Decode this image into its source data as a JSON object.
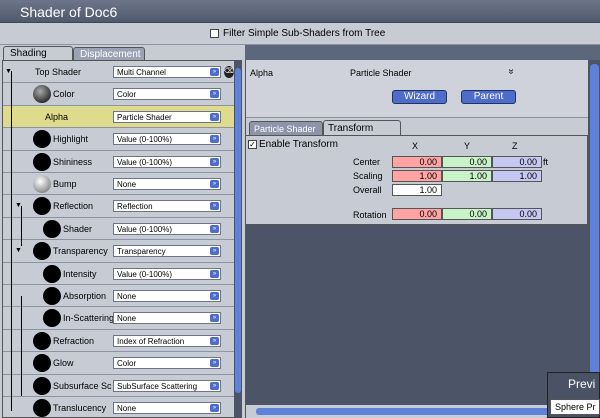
{
  "window": {
    "title": "Shader of Doc6"
  },
  "filter": {
    "label": "Filter Simple Sub-Shaders from Tree",
    "checked": false
  },
  "left_tabs": [
    {
      "label": "Shading",
      "active": true
    },
    {
      "label": "Displacement",
      "active": false
    }
  ],
  "tree": [
    {
      "label": "Top Shader",
      "value": "Multi Channel",
      "level": 0,
      "swatch": "none",
      "expanded": true
    },
    {
      "label": "Color",
      "value": "Color",
      "level": 1,
      "swatch": "grey"
    },
    {
      "label": "Alpha",
      "value": "Particle Shader",
      "level": 1,
      "swatch": "none",
      "selected": true
    },
    {
      "label": "Highlight",
      "value": "Value (0-100%)",
      "level": 1,
      "swatch": "black"
    },
    {
      "label": "Shininess",
      "value": "Value (0-100%)",
      "level": 1,
      "swatch": "black"
    },
    {
      "label": "Bump",
      "value": "None",
      "level": 1,
      "swatch": "light"
    },
    {
      "label": "Reflection",
      "value": "Reflection",
      "level": 1,
      "swatch": "black",
      "expanded": true
    },
    {
      "label": "Shader",
      "value": "Value (0-100%)",
      "level": 2,
      "swatch": "black"
    },
    {
      "label": "Transparency",
      "value": "Transparency",
      "level": 1,
      "swatch": "black",
      "expanded": true
    },
    {
      "label": "Intensity",
      "value": "Value (0-100%)",
      "level": 2,
      "swatch": "black"
    },
    {
      "label": "Absorption",
      "value": "None",
      "level": 2,
      "swatch": "black"
    },
    {
      "label": "In-Scattering",
      "value": "None",
      "level": 2,
      "swatch": "black"
    },
    {
      "label": "Refraction",
      "value": "Index of Refraction",
      "level": 1,
      "swatch": "black"
    },
    {
      "label": "Glow",
      "value": "Color",
      "level": 1,
      "swatch": "black"
    },
    {
      "label": "Subsurface Sc",
      "value": "SubSurface Scattering",
      "level": 1,
      "swatch": "black"
    },
    {
      "label": "Translucency",
      "value": "None",
      "level": 1,
      "swatch": "black"
    }
  ],
  "right_header": {
    "channel": "Alpha",
    "shader_type": "Particle Shader",
    "collapse_glyph": "»",
    "wizard_label": "Wizard",
    "parent_label": "Parent"
  },
  "right_tabs": [
    {
      "label": "Particle Shader",
      "active": false
    },
    {
      "label": "Transform",
      "active": true
    }
  ],
  "transform": {
    "enable_label": "Enable Transform",
    "enabled": true,
    "col_x": "X",
    "col_y": "Y",
    "col_z": "Z",
    "center_label": "Center",
    "center": [
      "0.00",
      "0.00",
      "0.00"
    ],
    "center_unit": "ft",
    "scaling_label": "Scaling",
    "scaling": [
      "1.00",
      "1.00",
      "1.00"
    ],
    "overall_label": "Overall",
    "overall": "1.00",
    "rotation_label": "Rotation",
    "rotation": [
      "0.00",
      "0.00",
      "0.00"
    ]
  },
  "preview": {
    "title": "Previ",
    "shape": "Sphere Pr"
  },
  "icons": {
    "trash": "trash-icon",
    "dropdown": "dropdown-arrow-icon",
    "check": "✓"
  },
  "colors": {
    "selected_row": "#dfdb8c",
    "button": "#4e6cc9",
    "x_field": "#ffa3a3",
    "y_field": "#c8f2c8",
    "z_field": "#c6c8f4"
  }
}
